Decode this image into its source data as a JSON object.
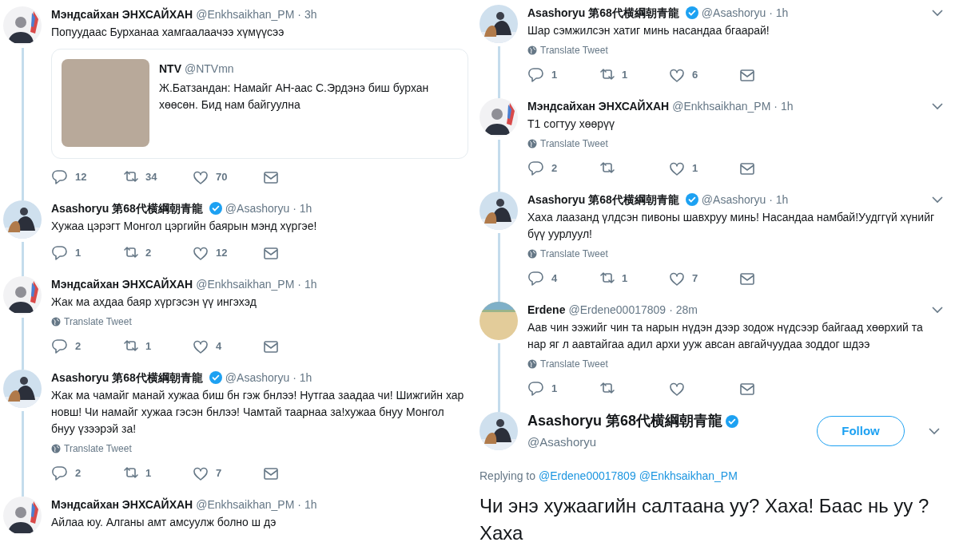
{
  "columns": [
    {
      "show_chevrons": false,
      "tweets": [
        {
          "avatar": {
            "kind": "pm"
          },
          "name": "Мэндсайхан ЭНХСАЙХАН",
          "verified": false,
          "handle": "@Enkhsaikhan_PM",
          "time": "· 3h",
          "text": "Попуудаас Бурханаа хамгаалаачээ хүмүүсээ",
          "quote": {
            "name": "NTV",
            "handle": "@NTVmn",
            "text": "Ж.Батзандан: Намайг АН-аас С.Эрдэнэ биш бурхан хөөсөн. Бид нам байгуулна"
          },
          "actions": {
            "replies": "12",
            "retweets": "34",
            "likes": "70"
          },
          "thread": true
        },
        {
          "avatar": {
            "kind": "dog"
          },
          "name": "Asashoryu 第68代横綱朝青龍",
          "verified": true,
          "handle": "@Asashoryu",
          "time": "· 1h",
          "text": "Хужаа цэрэгт Монгол цэргийн баярын мэнд хүргэе!",
          "actions": {
            "replies": "1",
            "retweets": "2",
            "likes": "12"
          },
          "thread": true
        },
        {
          "avatar": {
            "kind": "pm"
          },
          "name": "Мэндсайхан ЭНХСАЙХАН",
          "verified": false,
          "handle": "@Enkhsaikhan_PM",
          "time": "· 1h",
          "text": "Жак ма ахдаа баяр хүргэсэн үү ингэхэд",
          "translate": "Translate Tweet",
          "actions": {
            "replies": "2",
            "retweets": "1",
            "likes": "4"
          },
          "thread": true
        },
        {
          "avatar": {
            "kind": "dog"
          },
          "name": "Asashoryu 第68代横綱朝青龍",
          "verified": true,
          "handle": "@Asashoryu",
          "time": "· 1h",
          "text": "Жак ма чамайг манай хужаа биш бн гэж бнлээ! Нутгаа заадаа чи! Шижгийн хар новш! Чи намайг хужаа гэсэн бнлээ! Чамтай таарнаа за!хужаа бнуу Монгол бнуу үзээрэй за!",
          "translate": "Translate Tweet",
          "actions": {
            "replies": "2",
            "retweets": "1",
            "likes": "7"
          },
          "thread": true
        },
        {
          "avatar": {
            "kind": "pm"
          },
          "name": "Мэндсайхан ЭНХСАЙХАН",
          "verified": false,
          "handle": "@Enkhsaikhan_PM",
          "time": "· 1h",
          "text": "Айлаа юу. Алганы амт амсуулж болно ш дэ",
          "thread": false
        }
      ]
    },
    {
      "show_chevrons": true,
      "tweets": [
        {
          "avatar": {
            "kind": "dog"
          },
          "name": "Asashoryu 第68代横綱朝青龍",
          "verified": true,
          "handle": "@Asashoryu",
          "time": "· 1h",
          "text": "Шар сэмжилсэн хатиг минь насандаа бгаарай!",
          "translate": "Translate Tweet",
          "actions": {
            "replies": "1",
            "retweets": "1",
            "likes": "6"
          },
          "thread": true
        },
        {
          "avatar": {
            "kind": "pm"
          },
          "name": "Мэндсайхан ЭНХСАЙХАН",
          "verified": false,
          "handle": "@Enkhsaikhan_PM",
          "time": "· 1h",
          "text": "Т1 согтуу хөөрүү",
          "translate": "Translate Tweet",
          "actions": {
            "replies": "2",
            "likes": "1"
          },
          "thread": true
        },
        {
          "avatar": {
            "kind": "dog"
          },
          "name": "Asashoryu 第68代横綱朝青龍",
          "verified": true,
          "handle": "@Asashoryu",
          "time": "· 1h",
          "text": "Хаха лаазанд үлдсэн пивоны шавхруу минь! Насандаа намбай!Уудггүй хүнийг бүү уурлуул!",
          "translate": "Translate Tweet",
          "actions": {
            "replies": "4",
            "retweets": "1",
            "likes": "7"
          },
          "thread": true
        },
        {
          "avatar": {
            "kind": "beach"
          },
          "name": "Erdene",
          "verified": false,
          "handle": "@Erdene00017809",
          "time": "· 28m",
          "text": "Аав чин ээжийг чин та нарын нүдэн дээр зодож нүдсээр байгаад хөөрхий та нар яг л аавтайгаа адил архи ууж авсан авгайчуудаа зоддог шдээ",
          "translate": "Translate Tweet",
          "actions": {
            "replies": "1"
          },
          "thread": true
        }
      ],
      "main_tweet": {
        "avatar": {
          "kind": "dog"
        },
        "name": "Asashoryu 第68代横綱朝青龍",
        "verified": true,
        "handle": "@Asashoryu",
        "follow": "Follow",
        "replying_label": "Replying to",
        "replying_to": [
          "@Erdene00017809",
          "@Enkhsaikhan_PM"
        ],
        "text": "Чи энэ хужаагийн салтаана уу? Хаха! Баас нь уу ? Хаха"
      }
    }
  ]
}
